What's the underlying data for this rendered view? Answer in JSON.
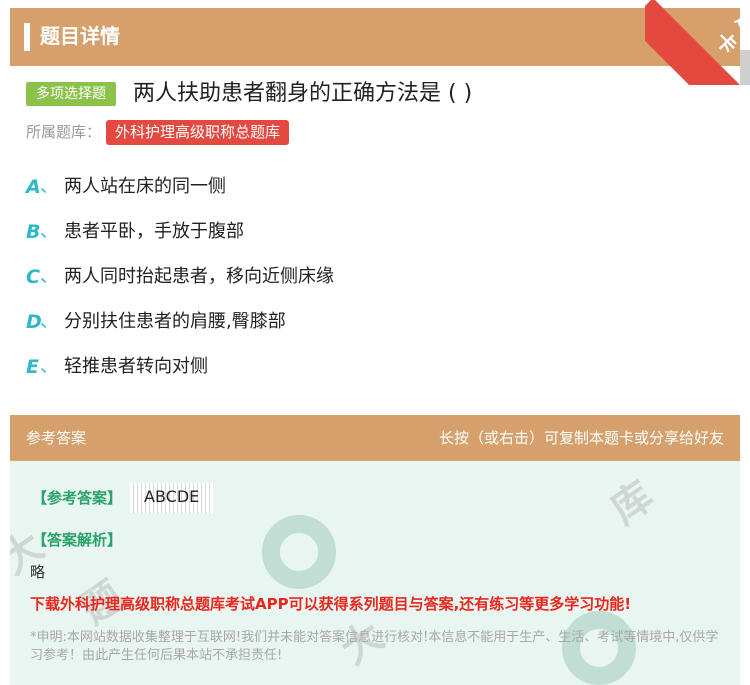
{
  "header": {
    "title": "题目详情"
  },
  "corner_badge": {
    "text": "题卡",
    "color": "#e4493f"
  },
  "question": {
    "type_tag": "多项选择题",
    "title": "两人扶助患者翻身的正确方法是 ( )",
    "bank_label": "所属题库：",
    "bank_name": "外科护理高级职称总题库"
  },
  "options": [
    {
      "letter": "A",
      "sep": "、",
      "text": "两人站在床的同一侧"
    },
    {
      "letter": "B",
      "sep": "、",
      "text": "患者平卧，手放于腹部"
    },
    {
      "letter": "C",
      "sep": "、",
      "text": "两人同时抬起患者，移向近侧床缘"
    },
    {
      "letter": "D",
      "sep": "、",
      "text": "分别扶住患者的肩腰,臀膝部"
    },
    {
      "letter": "E",
      "sep": "、",
      "text": "轻推患者转向对侧"
    }
  ],
  "answer_section": {
    "header_left": "参考答案",
    "header_right": "长按（或右击）可复制本题卡或分享给好友",
    "answer_label": "【参考答案】",
    "answer_value": "ABCDE",
    "analysis_label": "【答案解析】",
    "analysis_text": "略",
    "promo": "下载外科护理高级职称总题库考试APP可以获得系列题目与答案,还有练习等更多学习功能!",
    "disclaimer": "*申明:本网站数据收集整理于互联网!我们并未能对答案信息进行核对!本信息不能用于生产、生活、考试等情境中,仅供学习参考！由此产生任何后果本站不承担责任!"
  },
  "colors": {
    "header_bg": "#d5a06c",
    "option_letter": "#2fb8c8",
    "type_tag_bg": "#8bc34a",
    "bank_tag_bg": "#e4493f",
    "answer_label": "#2aa36b",
    "promo": "#e8281e"
  }
}
